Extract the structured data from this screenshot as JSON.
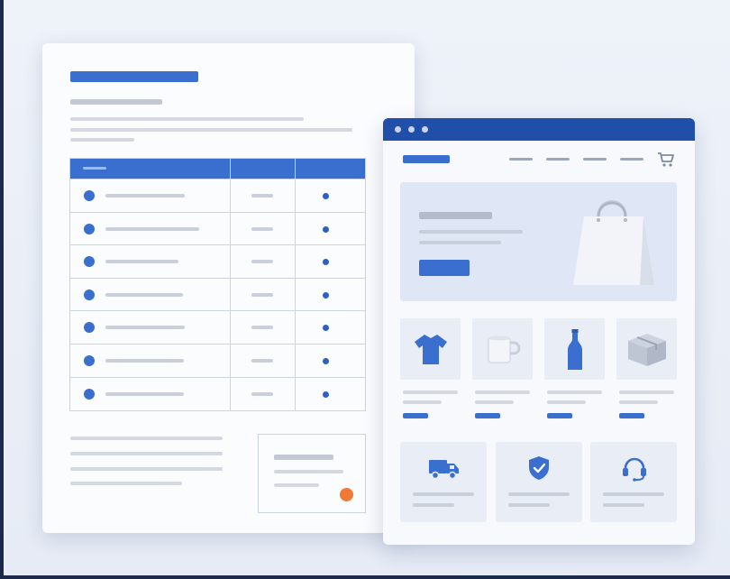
{
  "illustration": {
    "colors": {
      "primary": "#3a6fd0",
      "dark_blue": "#1f4fa8",
      "placeholder": "#cfd5e0",
      "accent_orange": "#f07a35"
    },
    "document": {
      "table_rows": 7,
      "signature_stamp": "orange-dot"
    },
    "shop_window": {
      "cart_icon": "shopping-cart-icon",
      "hero_image": "shopping-bag-icon",
      "products": [
        "t-shirt-icon",
        "mug-icon",
        "bottle-icon",
        "box-icon"
      ],
      "services": [
        "delivery-truck-icon",
        "shield-check-icon",
        "headset-icon"
      ]
    }
  }
}
